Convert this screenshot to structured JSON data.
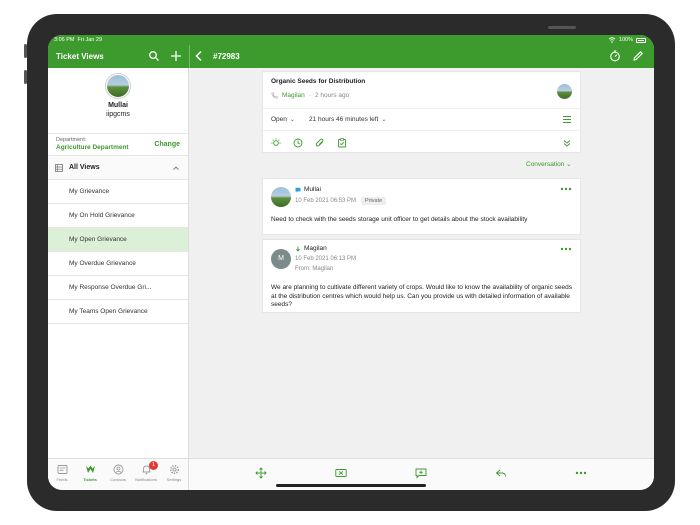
{
  "status_bar": {
    "time": "3:06 PM",
    "date": "Fri Jan 29",
    "battery": "100%"
  },
  "header": {
    "left_title": "Ticket Views",
    "ticket_id": "#72983",
    "icons": [
      "search-icon",
      "plus-icon",
      "back-chevron-icon",
      "timer-icon",
      "edit-pencil-icon"
    ]
  },
  "profile": {
    "name": "Mullai",
    "handle": "iipgcms"
  },
  "department": {
    "label": "Department:",
    "value": "Agriculture Department",
    "action": "Change"
  },
  "views": {
    "header": "All Views",
    "items": [
      {
        "label": "My Grievance"
      },
      {
        "label": "My On Hold Grievance"
      },
      {
        "label": "My Open Grievance"
      },
      {
        "label": "My Overdue Grievance"
      },
      {
        "label": "My Response Overdue Gri..."
      },
      {
        "label": "My Teams Open Grievance"
      }
    ],
    "selected_index": 2
  },
  "tabs": [
    {
      "label": "Feeds"
    },
    {
      "label": "Tickets"
    },
    {
      "label": "Contacts"
    },
    {
      "label": "Notifications",
      "badge": "1"
    },
    {
      "label": "Settings"
    }
  ],
  "ticket": {
    "subject": "Organic Seeds for Distribution",
    "agent": "Magilan",
    "time_ago": "2 hours ago",
    "status": "Open",
    "sla": "21 hours 46 minutes left"
  },
  "conversation_toggle": "Conversation",
  "messages": [
    {
      "author": "Mullai",
      "datetime": "10 Feb 2021 06:53 PM",
      "tag": "Private",
      "body": "Need to check with the seeds storage unit officer to get details about the stock availability"
    },
    {
      "author": "Magilan",
      "avatar_letter": "M",
      "datetime": "10 Feb 2021 06:13 PM",
      "from": "From: Magilan",
      "body": "We are planning to cultivate different variety of crops. Would like to know the availability of organic seeds at the distribution centres which would help us. Can you provide us with detailed information of available seeds?"
    }
  ],
  "colors": {
    "accent": "#3d9a2c",
    "selected_bg": "#dcefd7",
    "badge": "#e53935"
  }
}
